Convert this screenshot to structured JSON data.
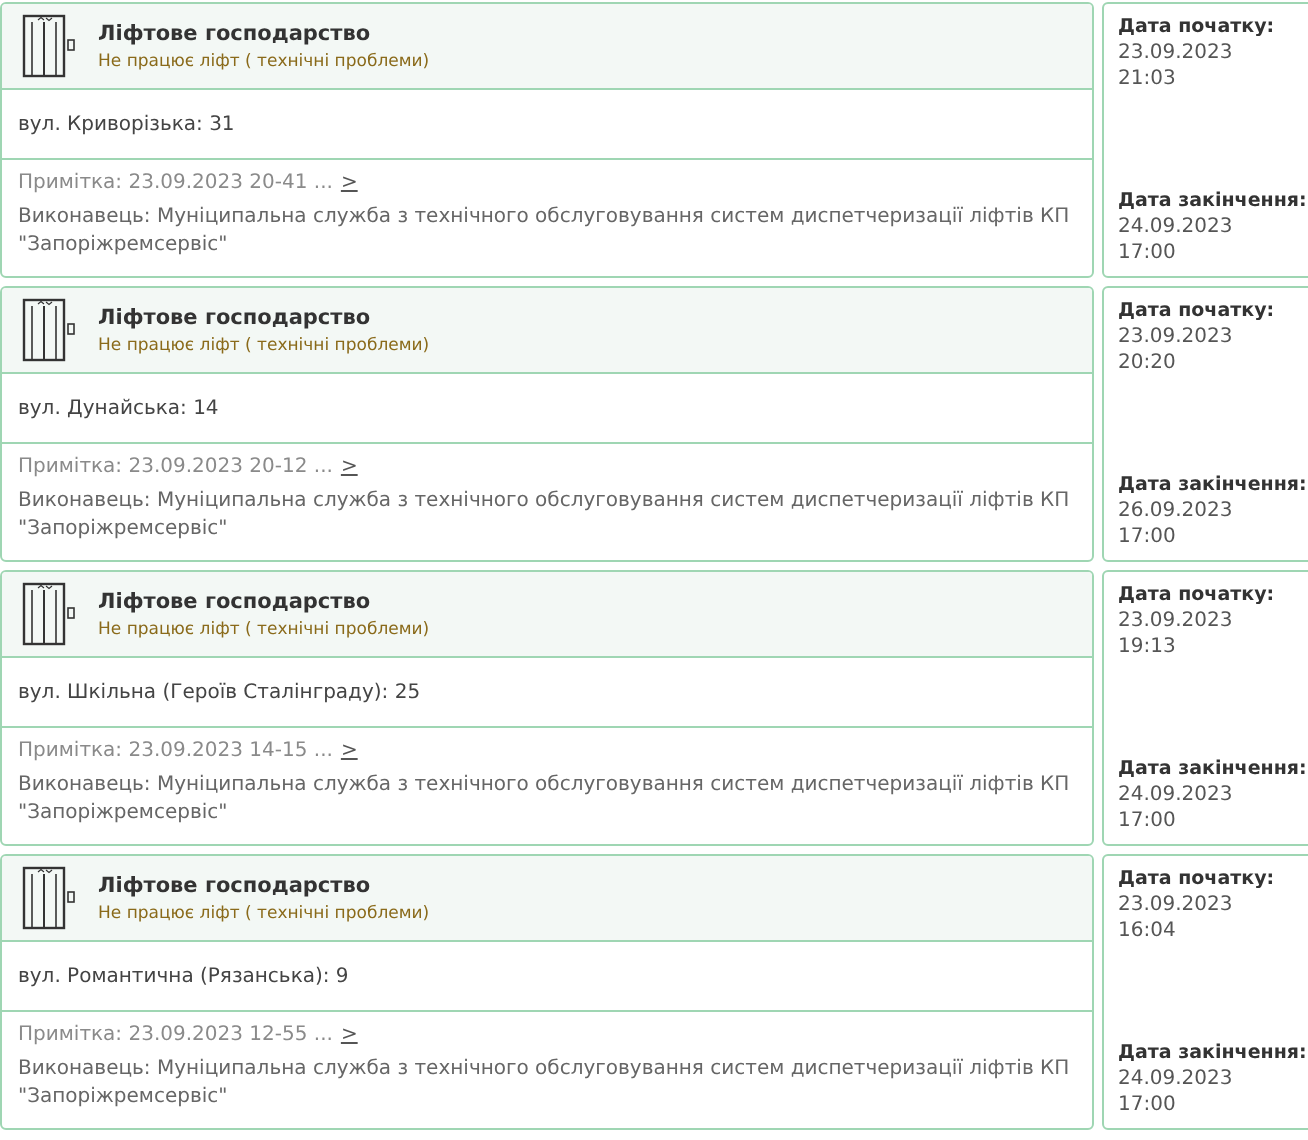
{
  "incidents": [
    {
      "category": "Ліфтове господарство",
      "problem": "Не працює ліфт ( технічні проблеми)",
      "address": "вул. Криворізька: 31",
      "note": "Примітка: 23.09.2023 20-41 ...",
      "more": ">",
      "executor": "Виконавець: Муніципальна служба з технічного обслуговування систем диспетчеризації ліфтів КП \"Запоріжремсервіс\"",
      "start_label": "Дата початку:",
      "start_date": "23.09.2023",
      "start_time": "21:03",
      "end_label": "Дата закінчення:",
      "end_date": "24.09.2023",
      "end_time": "17:00"
    },
    {
      "category": "Ліфтове господарство",
      "problem": "Не працює ліфт ( технічні проблеми)",
      "address": "вул. Дунайська: 14",
      "note": "Примітка: 23.09.2023 20-12 ...",
      "more": ">",
      "executor": "Виконавець: Муніципальна служба з технічного обслуговування систем диспетчеризації ліфтів КП \"Запоріжремсервіс\"",
      "start_label": "Дата початку:",
      "start_date": "23.09.2023",
      "start_time": "20:20",
      "end_label": "Дата закінчення:",
      "end_date": "26.09.2023",
      "end_time": "17:00"
    },
    {
      "category": "Ліфтове господарство",
      "problem": "Не працює ліфт ( технічні проблеми)",
      "address": "вул. Шкільна (Героїв Сталінграду): 25",
      "note": "Примітка: 23.09.2023 14-15 ...",
      "more": ">",
      "executor": "Виконавець: Муніципальна служба з технічного обслуговування систем диспетчеризації ліфтів КП \"Запоріжремсервіс\"",
      "start_label": "Дата початку:",
      "start_date": "23.09.2023",
      "start_time": "19:13",
      "end_label": "Дата закінчення:",
      "end_date": "24.09.2023",
      "end_time": "17:00"
    },
    {
      "category": "Ліфтове господарство",
      "problem": "Не працює ліфт ( технічні проблеми)",
      "address": "вул. Романтична (Рязанська): 9",
      "note": "Примітка: 23.09.2023 12-55 ...",
      "more": ">",
      "executor": "Виконавець: Муніципальна служба з технічного обслуговування систем диспетчеризації ліфтів КП \"Запоріжремсервіс\"",
      "start_label": "Дата початку:",
      "start_date": "23.09.2023",
      "start_time": "16:04",
      "end_label": "Дата закінчення:",
      "end_date": "24.09.2023",
      "end_time": "17:00"
    }
  ]
}
